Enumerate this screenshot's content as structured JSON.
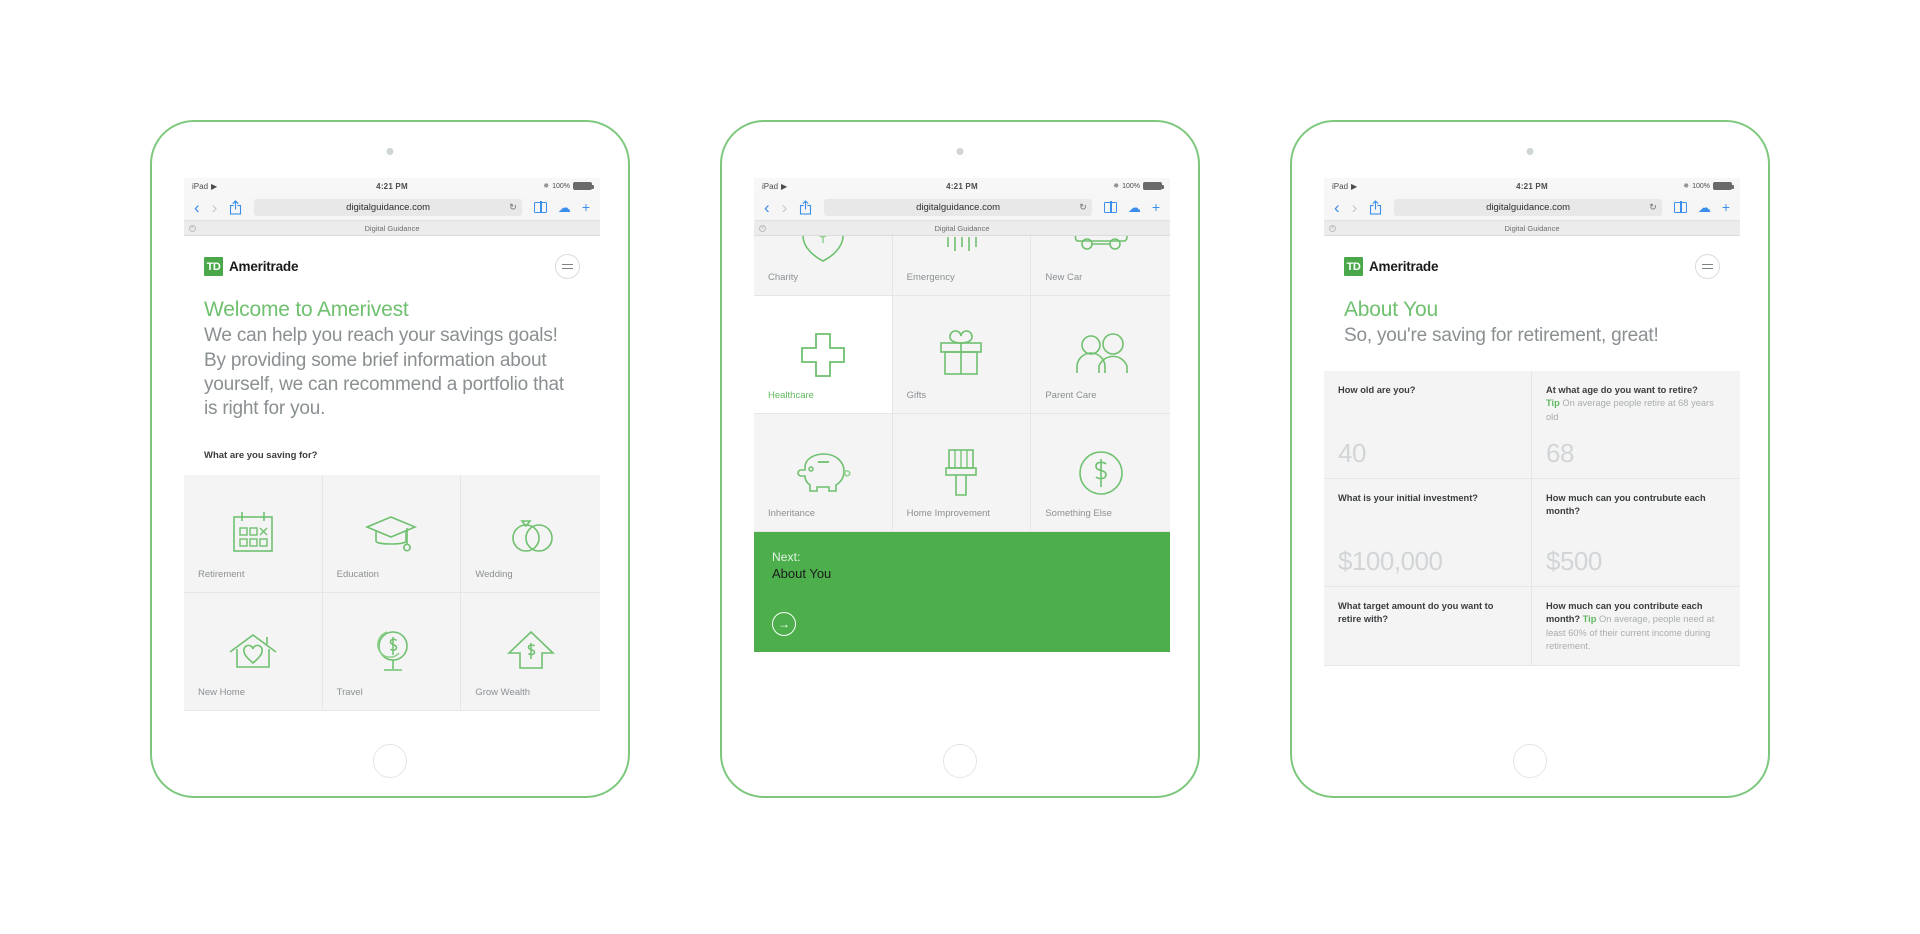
{
  "ios": {
    "carrier": "iPad",
    "wifi_icon": "wifi-icon",
    "time": "4:21 PM",
    "bluetooth_icon": "bluetooth-icon",
    "battery_pct": "100%",
    "back_icon": "chevron-left-icon",
    "forward_icon": "chevron-right-icon",
    "share_icon": "share-icon",
    "url": "digitalguidance.com",
    "reload_icon": "reload-icon",
    "bookmarks_icon": "book-icon",
    "cloud_tabs_icon": "cloud-icon",
    "new_tab_icon": "plus-icon",
    "tab_title": "Digital Guidance",
    "tab_close_icon": "close-icon"
  },
  "brand": {
    "mark": "TD",
    "name": "Ameritrade",
    "menu_icon": "hamburger-icon",
    "accent_green": "#4caf4c",
    "light_green": "#6fc06f",
    "grey_text": "#8a8f91"
  },
  "screen1": {
    "hero_title": "Welcome to Amerivest",
    "hero_sub": "We can help you reach your savings goals! By providing some brief information about yourself, we can recommend a portfolio that is right for you.",
    "question": "What are you saving for?",
    "goals": [
      {
        "label": "Retirement",
        "icon": "calendar-icon",
        "active": false
      },
      {
        "label": "Education",
        "icon": "graduation-cap-icon",
        "active": false
      },
      {
        "label": "Wedding",
        "icon": "wedding-rings-icon",
        "active": false
      },
      {
        "label": "New Home",
        "icon": "house-heart-icon",
        "active": false
      },
      {
        "label": "Travel",
        "icon": "globe-dollar-icon",
        "active": false
      },
      {
        "label": "Grow Wealth",
        "icon": "up-arrow-dollar-icon",
        "active": false
      }
    ]
  },
  "screen2": {
    "goals": [
      {
        "label": "Charity",
        "icon": "shield-dollar-icon",
        "active": false
      },
      {
        "label": "Emergency",
        "icon": "rain-cloud-icon",
        "active": false
      },
      {
        "label": "New Car",
        "icon": "car-icon",
        "active": false
      },
      {
        "label": "Healthcare",
        "icon": "medical-cross-icon",
        "active": true
      },
      {
        "label": "Gifts",
        "icon": "gift-icon",
        "active": false
      },
      {
        "label": "Parent Care",
        "icon": "two-people-icon",
        "active": false
      },
      {
        "label": "Inheritance",
        "icon": "piggy-bank-icon",
        "active": false
      },
      {
        "label": "Home Improvement",
        "icon": "paintbrush-icon",
        "active": false
      },
      {
        "label": "Something Else",
        "icon": "circle-dollar-icon",
        "active": false
      }
    ],
    "next": {
      "kicker": "Next:",
      "title": "About You",
      "arrow_icon": "arrow-right-icon"
    }
  },
  "screen3": {
    "hero_title": "About You",
    "hero_sub": "So, you're saving for retirement, great!",
    "fields": [
      {
        "question": "How old are you?",
        "tip_label": "",
        "tip_text": "",
        "value": "40",
        "short": false
      },
      {
        "question": "At what age do you want to retire?",
        "tip_label": "Tip",
        "tip_text": "On average people retire at 68 years old",
        "value": "68",
        "short": false
      },
      {
        "question": "What is your initial investment?",
        "tip_label": "",
        "tip_text": "",
        "value": "$100,000",
        "short": false
      },
      {
        "question": "How much can you contrubute each month?",
        "tip_label": "",
        "tip_text": "",
        "value": "$500",
        "short": false
      },
      {
        "question": "What target amount do you want to retire with?",
        "tip_label": "",
        "tip_text": "",
        "value": "",
        "short": true
      },
      {
        "question": "How much can you contribute each month?",
        "tip_label": "Tip",
        "tip_text": "On average, people need at least 60% of their current income during retirement.",
        "value": "",
        "short": true
      }
    ]
  }
}
